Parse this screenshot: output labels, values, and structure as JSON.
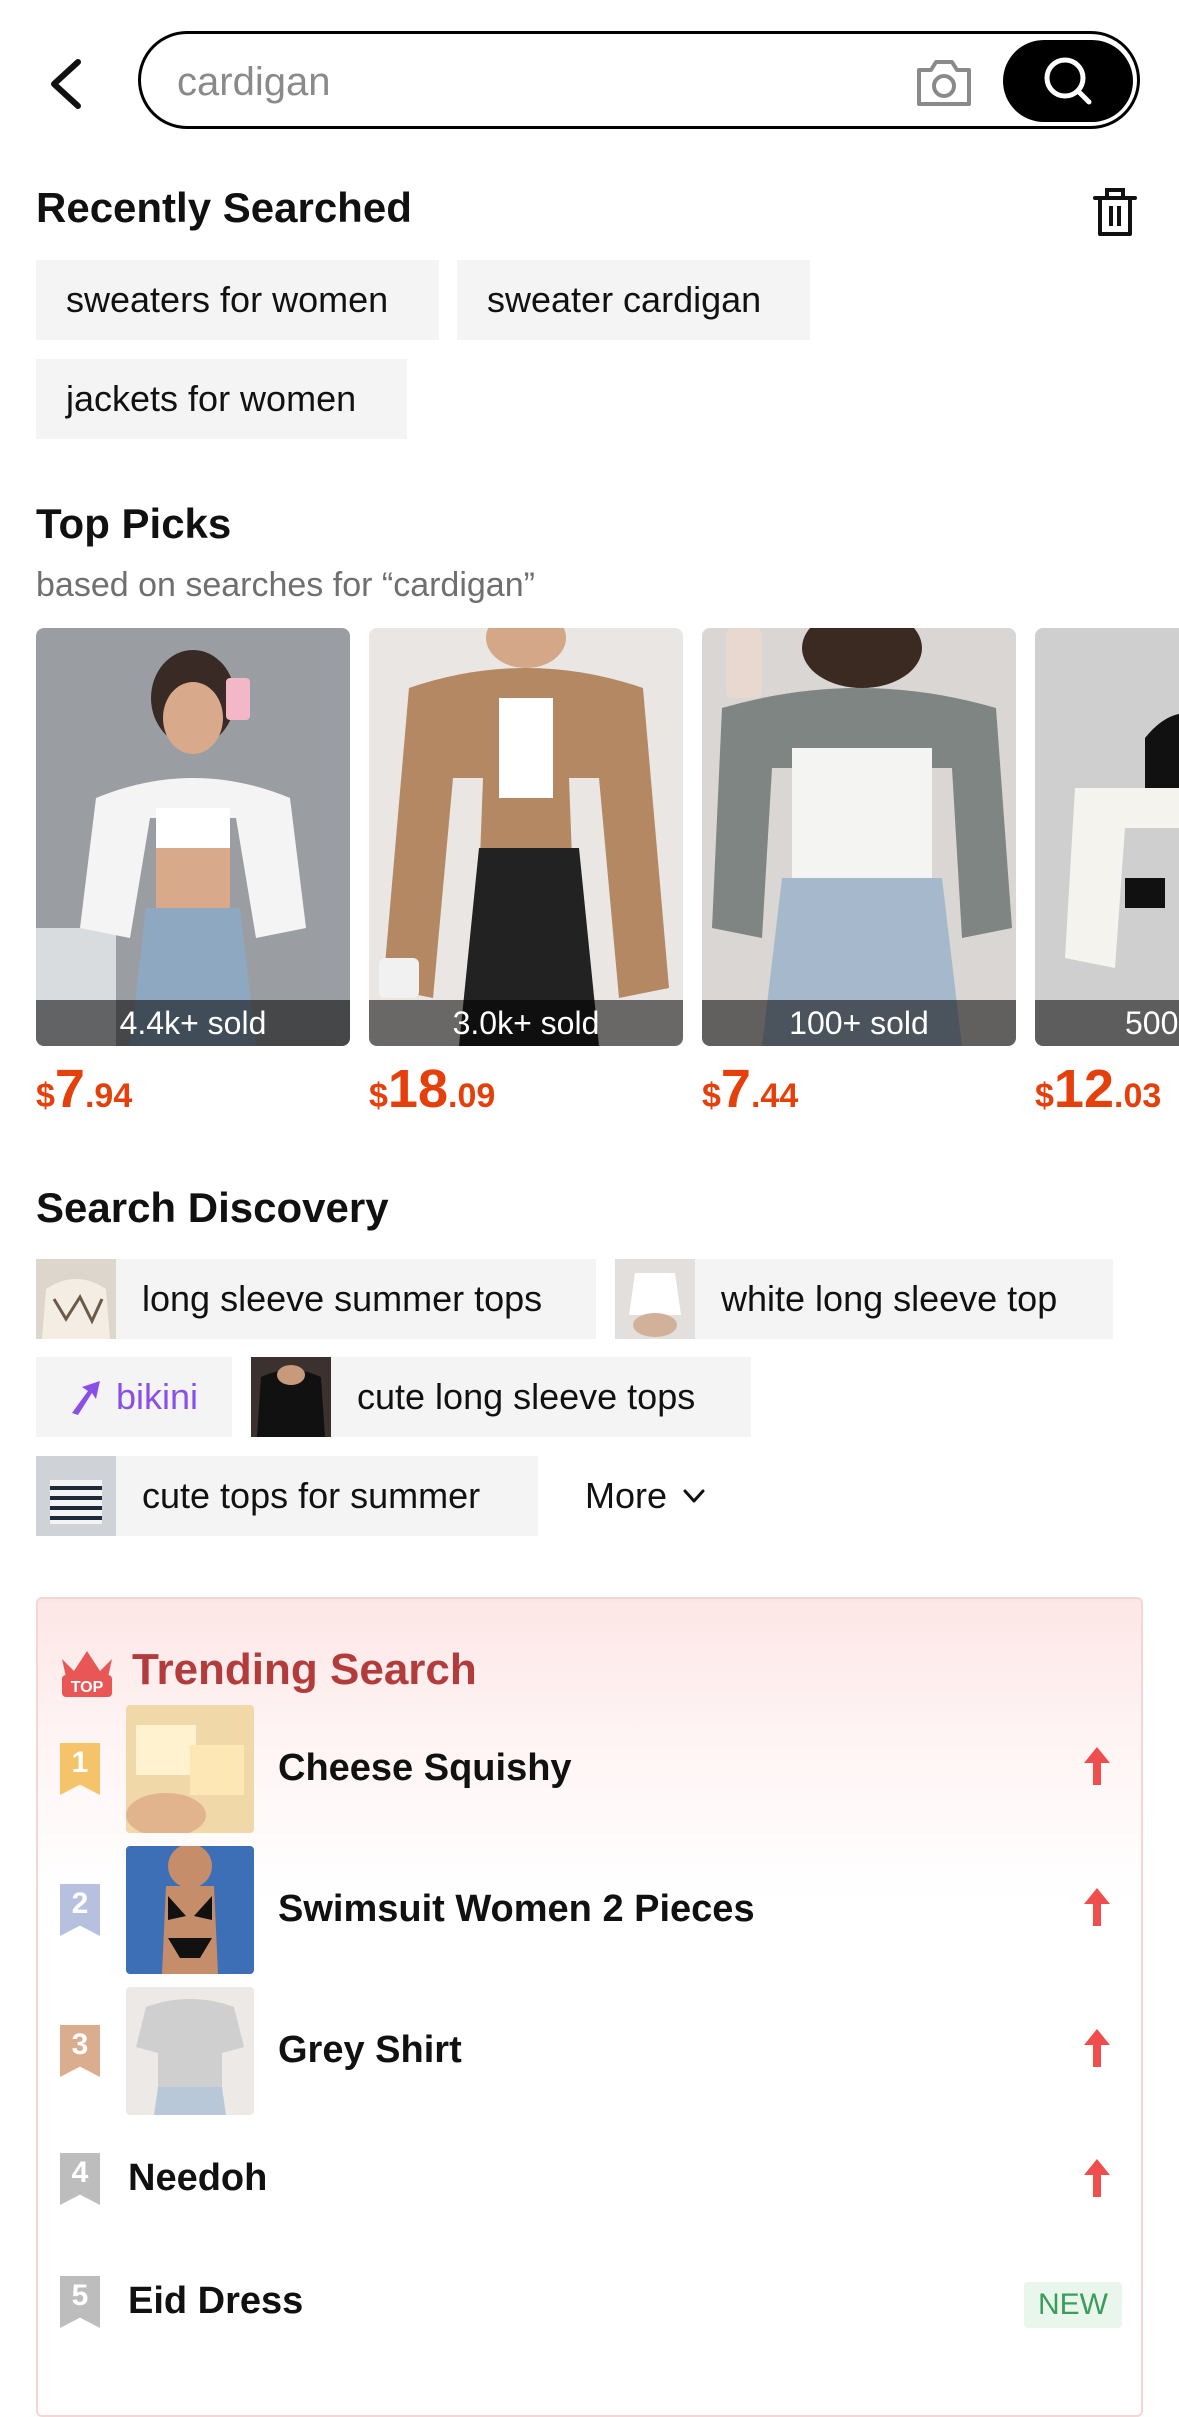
{
  "search": {
    "value": "cardigan",
    "placeholder": "cardigan"
  },
  "recent": {
    "title": "Recently Searched",
    "items": [
      "sweaters for women",
      "sweater cardigan",
      "jackets for women"
    ]
  },
  "top_picks": {
    "title": "Top Picks",
    "subtitle": "based on searches for “cardigan”",
    "products": [
      {
        "sold": "4.4k+ sold",
        "price_currency": "$",
        "price_int": "7",
        "price_dec": ".94"
      },
      {
        "sold": "3.0k+ sold",
        "price_currency": "$",
        "price_int": "18",
        "price_dec": ".09"
      },
      {
        "sold": "100+ sold",
        "price_currency": "$",
        "price_int": "7",
        "price_dec": ".44"
      },
      {
        "sold": "500",
        "price_currency": "$",
        "price_int": "12",
        "price_dec": ".03"
      }
    ]
  },
  "discovery": {
    "title": "Search Discovery",
    "items": [
      "long sleeve summer tops",
      "white long sleeve top",
      "bikini",
      "cute long sleeve tops",
      "cute tops for summer"
    ],
    "more_label": "More"
  },
  "trending": {
    "title": "Trending Search",
    "badge_text": "TOP",
    "items": [
      {
        "rank": "1",
        "label": "Cheese Squishy",
        "status": "up"
      },
      {
        "rank": "2",
        "label": "Swimsuit Women 2 Pieces",
        "status": "up"
      },
      {
        "rank": "3",
        "label": "Grey Shirt",
        "status": "up"
      },
      {
        "rank": "4",
        "label": "Needoh",
        "status": "up"
      },
      {
        "rank": "5",
        "label": "Eid Dress",
        "status": "NEW"
      }
    ]
  },
  "colors": {
    "price": "#e5400c",
    "trending_title": "#b23c3c",
    "rank1": "#f5c46a",
    "rank2": "#b7c0de",
    "rank3": "#d9ad8d",
    "rank_other": "#bdbdbd",
    "up_arrow": "#f04e4e",
    "bikini_accent": "#8a4fe6"
  }
}
